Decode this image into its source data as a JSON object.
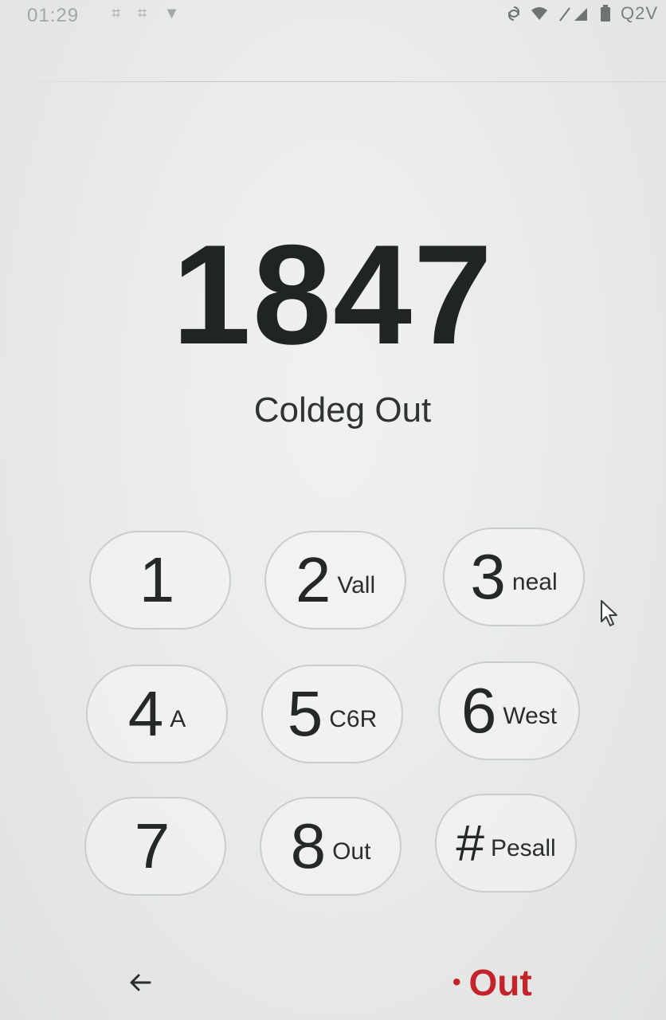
{
  "status_bar": {
    "time": "01:29",
    "left_icons": "⌗ ⌗ ▼",
    "battery_text": "Q2V"
  },
  "dialer": {
    "number": "1847",
    "caller_label": "Coldeg Out"
  },
  "keypad": {
    "keys": [
      {
        "digit": "1",
        "letters": ""
      },
      {
        "digit": "2",
        "letters": "Vall"
      },
      {
        "digit": "3",
        "letters": "neal"
      },
      {
        "digit": "4",
        "letters": "A"
      },
      {
        "digit": "5",
        "letters": "C6R"
      },
      {
        "digit": "6",
        "letters": "West"
      },
      {
        "digit": "7",
        "letters": ""
      },
      {
        "digit": "8",
        "letters": "Out"
      },
      {
        "digit": "#",
        "letters": "Pesall"
      }
    ]
  },
  "bottom": {
    "back_icon": "back-arrow-icon",
    "out_label": "Out",
    "out_color": "#c5232c"
  }
}
